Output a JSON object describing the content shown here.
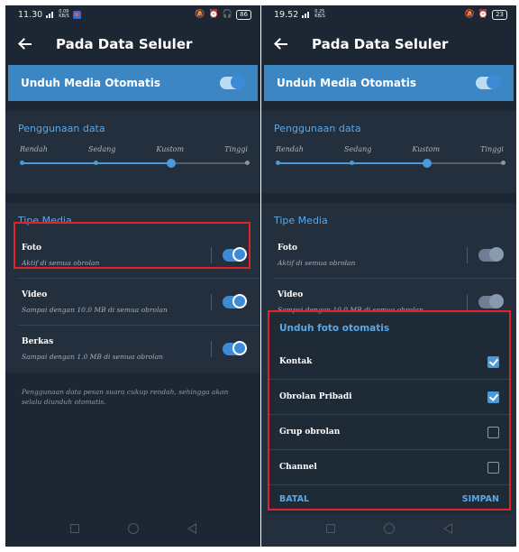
{
  "left": {
    "status": {
      "time": "11.30",
      "netspeed": "0.09 KB/S",
      "battery": "86"
    },
    "appbar": {
      "title": "Pada Data Seluler"
    },
    "auto_download": {
      "label": "Unduh Media Otomatis"
    },
    "usage": {
      "title": "Penggunaan data",
      "levels": [
        "Rendah",
        "Sedang",
        "Kustom",
        "Tinggi"
      ],
      "selected_index": 2
    },
    "media": {
      "title": "Tipe Media",
      "items": [
        {
          "name": "Foto",
          "sub": "Aktif di semua obrolan"
        },
        {
          "name": "Video",
          "sub": "Sampai dengan 10.0 MB di semua obrolan"
        },
        {
          "name": "Berkas",
          "sub": "Sampai dengan 1.0 MB di semua obrolan"
        }
      ]
    },
    "note": "Penggunaan data pesan suara cukup rendah, sehingga akan selalu diunduh otomatis."
  },
  "right": {
    "status": {
      "time": "19.52",
      "netspeed": "0.25 KB/S",
      "battery": "23"
    },
    "appbar": {
      "title": "Pada Data Seluler"
    },
    "auto_download": {
      "label": "Unduh Media Otomatis"
    },
    "usage": {
      "title": "Penggunaan data",
      "levels": [
        "Rendah",
        "Sedang",
        "Kustom",
        "Tinggi"
      ],
      "selected_index": 2
    },
    "media": {
      "title": "Tipe Media",
      "items": [
        {
          "name": "Foto",
          "sub": "Aktif di semua obrolan"
        },
        {
          "name": "Video",
          "sub": "Sampai dengan 10.0 MB di semua obrolan"
        }
      ]
    },
    "dialog": {
      "title": "Unduh foto otomatis",
      "options": [
        {
          "label": "Kontak",
          "checked": true
        },
        {
          "label": "Obrolan Pribadi",
          "checked": true
        },
        {
          "label": "Grup obrolan",
          "checked": false
        },
        {
          "label": "Channel",
          "checked": false
        }
      ],
      "cancel": "BATAL",
      "save": "SIMPAN"
    }
  },
  "colors": {
    "accent": "#4a9ad9",
    "highlight": "#e32329",
    "background": "#1d2734"
  }
}
